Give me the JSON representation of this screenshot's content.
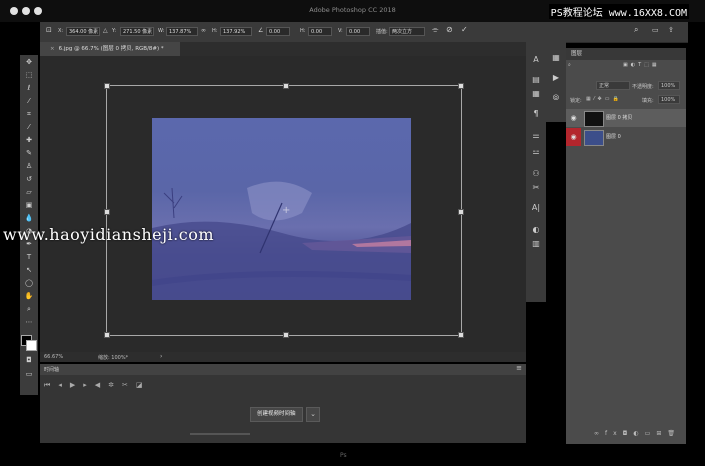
{
  "app": {
    "title": "Adobe Photoshop CC 2018"
  },
  "watermark_top": "PS教程论坛 www.16XX8.COM",
  "watermark_mid": "www.haoyidiansheji.com",
  "options": {
    "x_label": "X:",
    "x_value": "364.00 像素",
    "y_label": "Y:",
    "y_value": "271.50 像素",
    "w_label": "W:",
    "w_value": "137.87%",
    "h_label": "H:",
    "h_value": "137.92%",
    "angle_value": "0.00",
    "h_skew_label": "H:",
    "h_skew_value": "0.00",
    "v_skew_label": "V:",
    "v_skew_value": "0.00",
    "interp_label": "插值:",
    "interp_value": "两次立方"
  },
  "document": {
    "tab_label": "6.jpg @ 66.7% (图层 0 拷贝, RGB/8#) *"
  },
  "status": {
    "zoom": "66.67%",
    "doc_info": "缩放: 100%*"
  },
  "timeline": {
    "title": "时间轴",
    "create_button": "创建视频时间轴"
  },
  "layers_panel": {
    "tab": "图层",
    "blend_mode": "正常",
    "opacity_label": "不透明度:",
    "opacity_value": "100%",
    "fill_label": "填充:",
    "fill_value": "100%",
    "lock_label": "锁定:",
    "layers": [
      {
        "name": "图层 0 拷贝",
        "selected": true
      },
      {
        "name": "图层 0",
        "selected": false
      }
    ]
  },
  "bottom_logo": "Ps"
}
